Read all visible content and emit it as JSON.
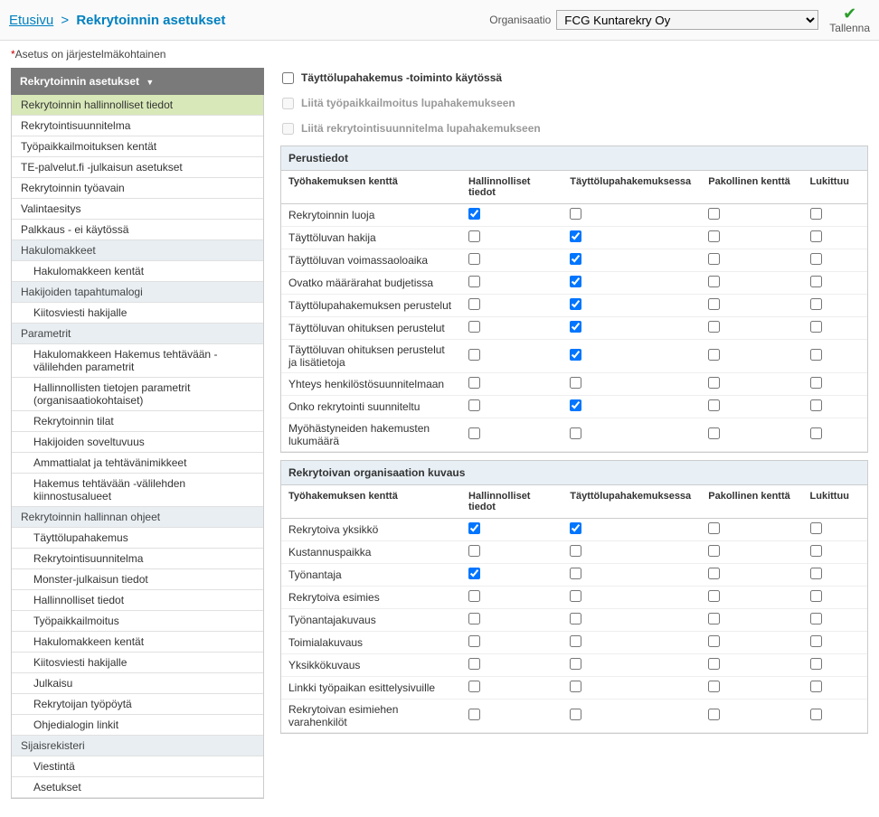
{
  "breadcrumb": {
    "home": "Etusivu",
    "sep": ">",
    "current": "Rekrytoinnin asetukset"
  },
  "org": {
    "label": "Organisaatio",
    "value": "FCG Kuntarekry Oy"
  },
  "save": {
    "label": "Tallenna"
  },
  "note": "Asetus on järjestelmäkohtainen",
  "sidebar": {
    "header": "Rekrytoinnin asetukset",
    "items": [
      {
        "label": "Rekrytoinnin hallinnolliset tiedot",
        "active": true
      },
      {
        "label": "Rekrytointisuunnitelma"
      },
      {
        "label": "Työpaikkailmoituksen kentät"
      },
      {
        "label": "TE-palvelut.fi -julkaisun asetukset"
      },
      {
        "label": "Rekrytoinnin työavain"
      },
      {
        "label": "Valintaesitys"
      },
      {
        "label": "Palkkaus - ei käytössä"
      },
      {
        "label": "Hakulomakkeet",
        "section": true
      },
      {
        "label": "Hakulomakkeen kentät",
        "indent": true
      },
      {
        "label": "Hakijoiden tapahtumalogi",
        "section": true
      },
      {
        "label": "Kiitosviesti hakijalle",
        "indent": true
      },
      {
        "label": "Parametrit",
        "section": true
      },
      {
        "label": "Hakulomakkeen Hakemus tehtävään -välilehden parametrit",
        "indent": true
      },
      {
        "label": "Hallinnollisten tietojen parametrit (organisaatiokohtaiset)",
        "indent": true
      },
      {
        "label": "Rekrytoinnin tilat",
        "indent": true
      },
      {
        "label": "Hakijoiden soveltuvuus",
        "indent": true
      },
      {
        "label": "Ammattialat ja tehtävänimikkeet",
        "indent": true
      },
      {
        "label": "Hakemus tehtävään -välilehden kiinnostusalueet",
        "indent": true
      },
      {
        "label": "Rekrytoinnin hallinnan ohjeet",
        "section": true
      },
      {
        "label": "Täyttölupahakemus",
        "indent": true
      },
      {
        "label": "Rekrytointisuunnitelma",
        "indent": true
      },
      {
        "label": "Monster-julkaisun tiedot",
        "indent": true
      },
      {
        "label": "Hallinnolliset tiedot",
        "indent": true
      },
      {
        "label": "Työpaikkailmoitus",
        "indent": true
      },
      {
        "label": "Hakulomakkeen kentät",
        "indent": true
      },
      {
        "label": "Kiitosviesti hakijalle",
        "indent": true
      },
      {
        "label": "Julkaisu",
        "indent": true
      },
      {
        "label": "Rekrytoijan työpöytä",
        "indent": true
      },
      {
        "label": "Ohjedialogin linkit",
        "indent": true
      },
      {
        "label": "Sijaisrekisteri",
        "section": true
      },
      {
        "label": "Viestintä",
        "indent": true
      },
      {
        "label": "Asetukset",
        "indent": true
      }
    ]
  },
  "options": [
    {
      "label": "Täyttölupahakemus -toiminto käytössä",
      "checked": false,
      "disabled": false
    },
    {
      "label": "Liitä työpaikkailmoitus lupahakemukseen",
      "checked": false,
      "disabled": true
    },
    {
      "label": "Liitä rekrytointisuunnitelma lupahakemukseen",
      "checked": false,
      "disabled": true
    }
  ],
  "columns": {
    "c1": "Työhakemuksen kenttä",
    "c2": "Hallinnolliset tiedot",
    "c3": "Täyttölupahakemuksessa",
    "c4": "Pakollinen kenttä",
    "c5": "Lukittuu"
  },
  "section1": {
    "title": "Perustiedot",
    "rows": [
      {
        "label": "Rekrytoinnin luoja",
        "h": true,
        "t": false,
        "p": false,
        "l": false
      },
      {
        "label": "Täyttöluvan hakija",
        "h": false,
        "t": true,
        "p": false,
        "l": false
      },
      {
        "label": "Täyttöluvan voimassaoloaika",
        "h": false,
        "t": true,
        "p": false,
        "l": false
      },
      {
        "label": "Ovatko määrärahat budjetissa",
        "h": false,
        "t": true,
        "p": false,
        "l": false
      },
      {
        "label": "Täyttölupahakemuksen perustelut",
        "h": false,
        "t": true,
        "p": false,
        "l": false
      },
      {
        "label": "Täyttöluvan ohituksen perustelut",
        "h": false,
        "t": true,
        "p": false,
        "l": false
      },
      {
        "label": "Täyttöluvan ohituksen perustelut ja lisätietoja",
        "h": false,
        "t": true,
        "p": false,
        "l": false
      },
      {
        "label": "Yhteys henkilöstösuunnitelmaan",
        "h": false,
        "t": false,
        "p": false,
        "l": false
      },
      {
        "label": "Onko rekrytointi suunniteltu",
        "h": false,
        "t": true,
        "p": false,
        "l": false
      },
      {
        "label": "Myöhästyneiden hakemusten lukumäärä",
        "h": false,
        "t": false,
        "p": false,
        "l": false
      }
    ]
  },
  "section2": {
    "title": "Rekrytoivan organisaation kuvaus",
    "rows": [
      {
        "label": "Rekrytoiva yksikkö",
        "h": true,
        "t": true,
        "p": false,
        "l": false
      },
      {
        "label": "Kustannuspaikka",
        "h": false,
        "t": false,
        "p": false,
        "l": false
      },
      {
        "label": "Työnantaja",
        "h": true,
        "t": false,
        "p": false,
        "l": false
      },
      {
        "label": "Rekrytoiva esimies",
        "h": false,
        "t": false,
        "p": false,
        "l": false
      },
      {
        "label": "Työnantajakuvaus",
        "h": false,
        "t": false,
        "p": false,
        "l": false
      },
      {
        "label": "Toimialakuvaus",
        "h": false,
        "t": false,
        "p": false,
        "l": false
      },
      {
        "label": "Yksikkökuvaus",
        "h": false,
        "t": false,
        "p": false,
        "l": false
      },
      {
        "label": "Linkki työpaikan esittelysivuille",
        "h": false,
        "t": false,
        "p": false,
        "l": false
      },
      {
        "label": "Rekrytoivan esimiehen varahenkilöt",
        "h": false,
        "t": false,
        "p": false,
        "l": false
      }
    ]
  }
}
